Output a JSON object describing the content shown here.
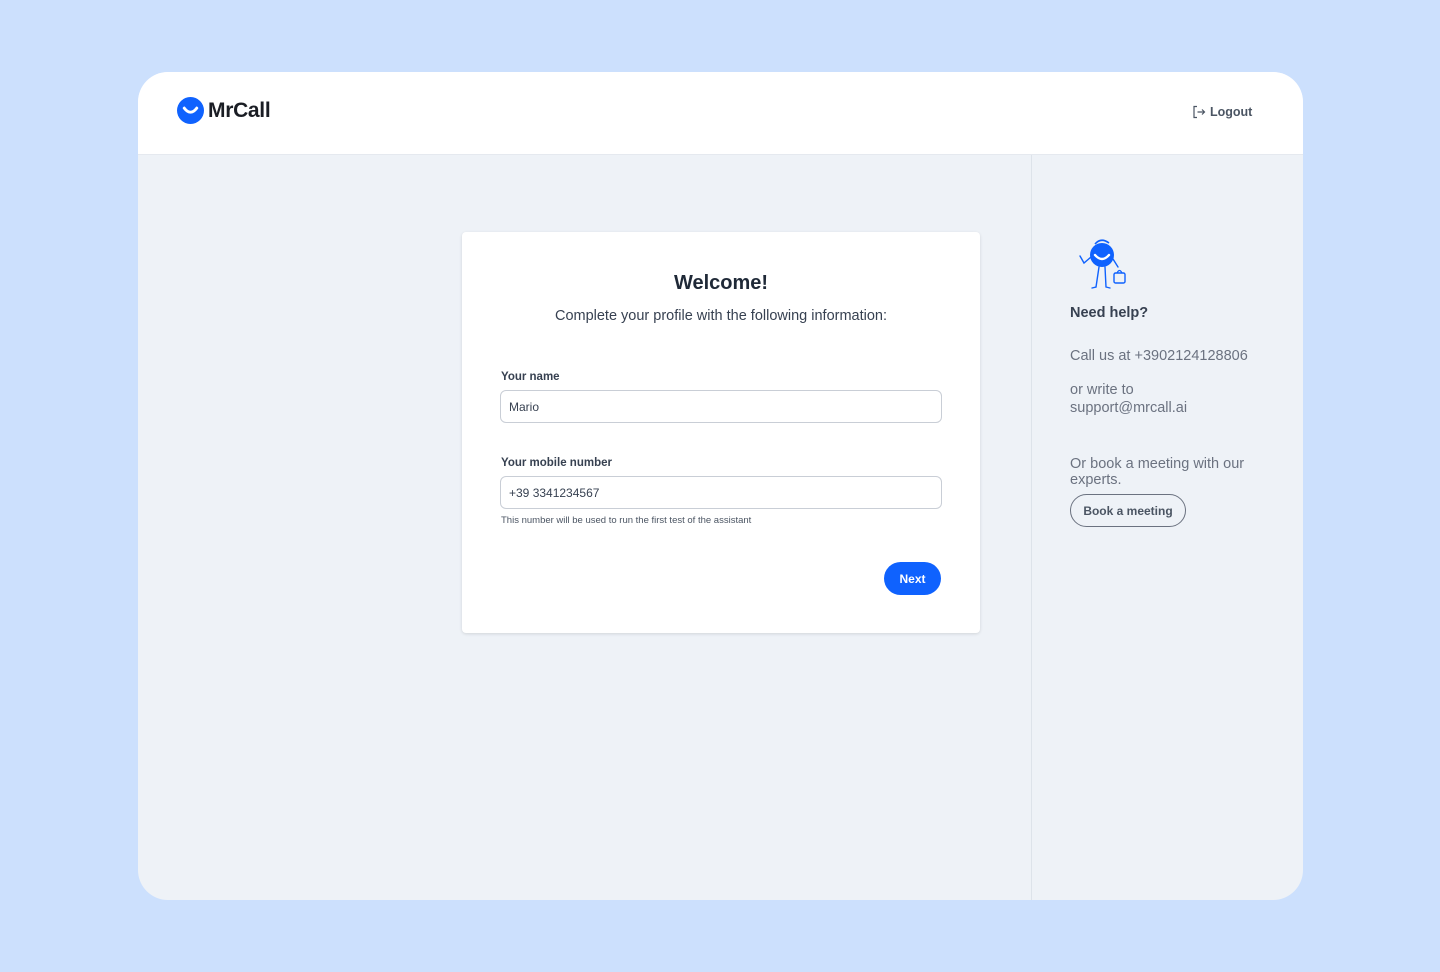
{
  "brand": {
    "name": "MrCall",
    "logo_icon": "mrcall-smile-logo",
    "accent": "#0f62fe"
  },
  "header": {
    "logout_label": "Logout",
    "logout_icon": "logout-icon"
  },
  "form": {
    "title": "Welcome!",
    "subtitle": "Complete your profile with the following information:",
    "name_label": "Your name",
    "name_value": "Mario",
    "phone_label": "Your mobile number",
    "phone_value": "+39 3341234567",
    "phone_hint": "This number will be used to run the first test of the assistant",
    "next_label": "Next"
  },
  "help": {
    "mascot_icon": "mascot-illustration",
    "title": "Need help?",
    "call_text": "Call us at +3902124128806",
    "write_text": "or write to support@mrcall.ai",
    "meeting_text": "Or book a meeting with our experts.",
    "book_label": "Book a meeting"
  }
}
